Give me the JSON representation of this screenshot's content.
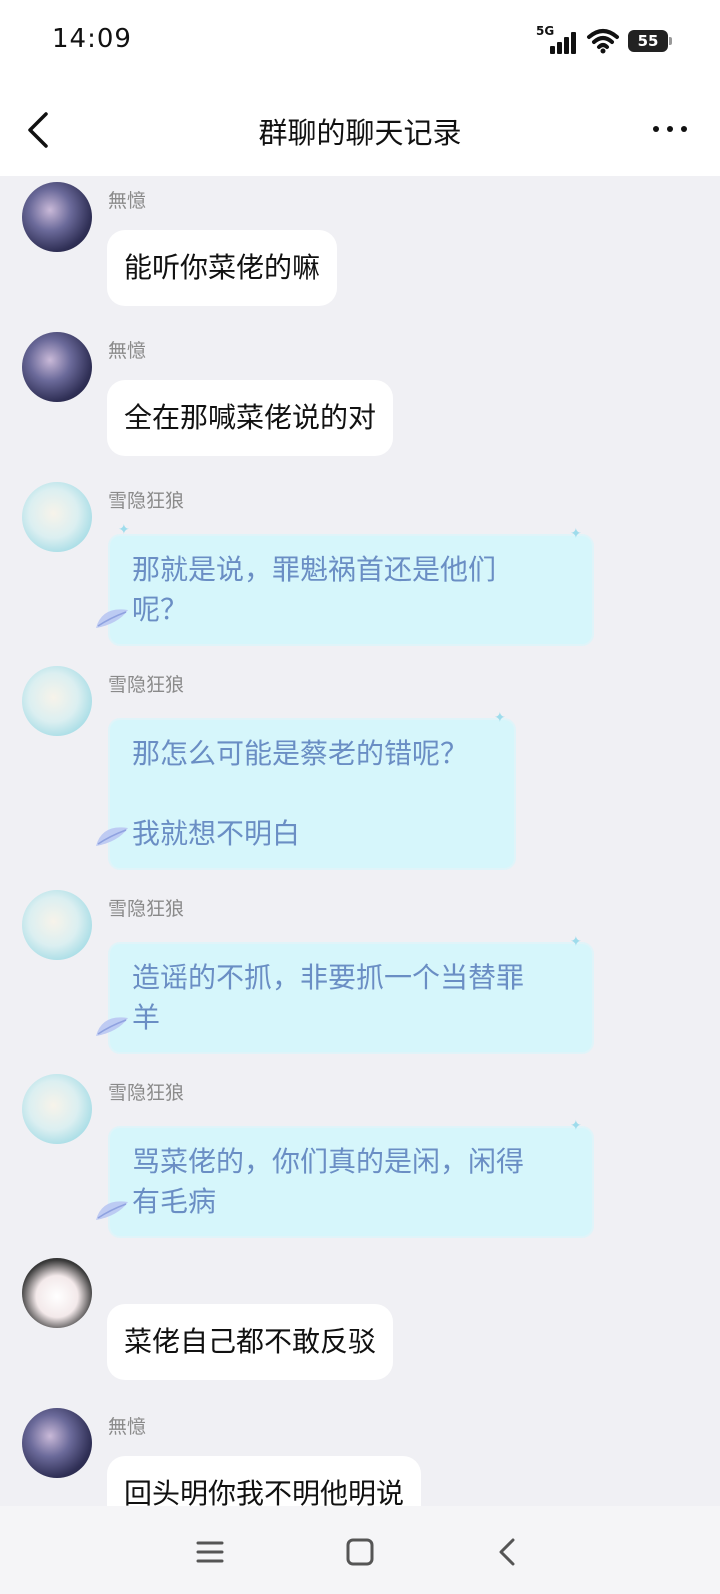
{
  "status_bar": {
    "time": "14:09",
    "network": "5G",
    "battery": "55",
    "icons": [
      "signal-icon",
      "wifi-icon",
      "battery-icon"
    ]
  },
  "header": {
    "title": "群聊的聊天记录",
    "back_icon": "chevron-left-icon",
    "more_icon": "more-dots-icon"
  },
  "messages": [
    {
      "sender": "無憶",
      "avatar": "avatar-dark",
      "text": "能听你菜佬的嘛"
    },
    {
      "sender": "無憶",
      "avatar": "avatar-dark",
      "text": "全在那喊菜佬说的对"
    },
    {
      "sender": "雪隐狂狼",
      "avatar": "avatar-light",
      "lines": [
        "那就是说，罪魁祸首还是他们",
        "呢？"
      ]
    },
    {
      "sender": "雪隐狂狼",
      "avatar": "avatar-light",
      "lines": [
        "那怎么可能是蔡老的错呢？",
        "我就想不明白"
      ]
    },
    {
      "sender": "雪隐狂狼",
      "avatar": "avatar-light",
      "lines": [
        "造谣的不抓，非要抓一个当替罪",
        "羊"
      ]
    },
    {
      "sender": "雪隐狂狼",
      "avatar": "avatar-light",
      "lines": [
        "骂菜佬的，你们真的是闲，闲得",
        "有毛病"
      ]
    },
    {
      "sender": "",
      "avatar": "avatar-girl",
      "text": "菜佬自己都不敢反驳"
    },
    {
      "sender": "無憶",
      "avatar": "avatar-dark",
      "text": "回头明你我不明他明说"
    }
  ],
  "nav": {
    "icons": [
      "menu-icon",
      "home-square-icon",
      "back-icon"
    ]
  },
  "colors": {
    "background": "#f0f0f4",
    "bubble_white": "#ffffff",
    "bubble_fancy": "#d6f6fb",
    "fancy_text": "#6a8ec4"
  }
}
